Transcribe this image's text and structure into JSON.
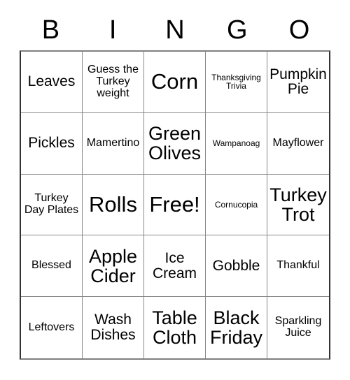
{
  "card": {
    "title": "BINGO",
    "headers": [
      "B",
      "I",
      "N",
      "G",
      "O"
    ],
    "free_space_label": "Free!",
    "border_color": "#333333",
    "grid_line_color": "#888888",
    "text_color": "#000000",
    "background_color": "#ffffff"
  },
  "rows": [
    {
      "cells": [
        {
          "text": "Leaves",
          "size": "sz-md"
        },
        {
          "text": "Guess the Turkey weight",
          "size": "sz-sm"
        },
        {
          "text": "Corn",
          "size": "sz-xl"
        },
        {
          "text": "Thanksgiving Trivia",
          "size": "sz-xs"
        },
        {
          "text": "Pumpkin Pie",
          "size": "sz-md"
        }
      ]
    },
    {
      "cells": [
        {
          "text": "Pickles",
          "size": "sz-md"
        },
        {
          "text": "Mamertino",
          "size": "sz-sm"
        },
        {
          "text": "Green Olives",
          "size": "sz-lg"
        },
        {
          "text": "Wampanoag",
          "size": "sz-xs"
        },
        {
          "text": "Mayflower",
          "size": "sz-sm"
        }
      ]
    },
    {
      "cells": [
        {
          "text": "Turkey Day Plates",
          "size": "sz-sm"
        },
        {
          "text": "Rolls",
          "size": "sz-xl"
        },
        {
          "text": "Free!",
          "size": "sz-xl"
        },
        {
          "text": "Cornucopia",
          "size": "sz-xs"
        },
        {
          "text": "Turkey Trot",
          "size": "sz-lg"
        }
      ]
    },
    {
      "cells": [
        {
          "text": "Blessed",
          "size": "sz-sm"
        },
        {
          "text": "Apple Cider",
          "size": "sz-lg"
        },
        {
          "text": "Ice Cream",
          "size": "sz-md"
        },
        {
          "text": "Gobble",
          "size": "sz-md"
        },
        {
          "text": "Thankful",
          "size": "sz-sm"
        }
      ]
    },
    {
      "cells": [
        {
          "text": "Leftovers",
          "size": "sz-sm"
        },
        {
          "text": "Wash Dishes",
          "size": "sz-md"
        },
        {
          "text": "Table Cloth",
          "size": "sz-lg"
        },
        {
          "text": "Black Friday",
          "size": "sz-lg"
        },
        {
          "text": "Sparkling Juice",
          "size": "sz-sm"
        }
      ]
    }
  ]
}
